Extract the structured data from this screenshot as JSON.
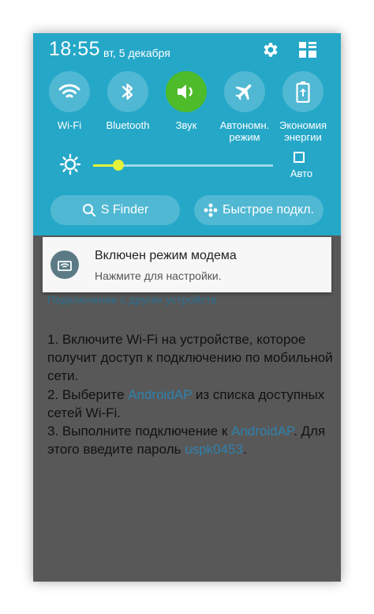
{
  "status": {
    "time": "18:55",
    "date": "вт, 5 декабря"
  },
  "toggles": [
    {
      "label": "Wi-Fi",
      "icon": "wifi-icon",
      "active": false
    },
    {
      "label": "Bluetooth",
      "icon": "bluetooth-icon",
      "active": false
    },
    {
      "label": "Звук",
      "icon": "sound-icon",
      "active": true
    },
    {
      "label": "Автономн. режим",
      "icon": "airplane-icon",
      "active": false
    },
    {
      "label": "Экономия энергии",
      "icon": "battery-saver-icon",
      "active": false
    }
  ],
  "brightness": {
    "level": 0.14,
    "auto_label": "Авто",
    "auto_checked": false
  },
  "buttons": {
    "s_finder": "S Finder",
    "quick_connect": "Быстрое подкл."
  },
  "notification": {
    "title": "Включен режим модема",
    "subtitle": "Нажмите для настройки."
  },
  "content": {
    "header": "Подключение с других устройств",
    "step1": "1. Включите Wi-Fi на устройстве, которое получит доступ к подключению по мобильной сети.",
    "step2_pre": "2. Выберите ",
    "step2_link": "AndroidAP",
    "step2_post": " из списка доступных сетей Wi-Fi.",
    "step3_pre": "3. Выполните подключение к ",
    "step3_link": "AndroidAP",
    "step3_post": ". Для этого введите пароль ",
    "step3_pass": "uspk0453",
    "step3_end": "."
  },
  "colors": {
    "panel": "#25a7c8",
    "sound_active": "#4dbb2a",
    "slider": "#e5f23a",
    "link": "#2e82ad"
  }
}
